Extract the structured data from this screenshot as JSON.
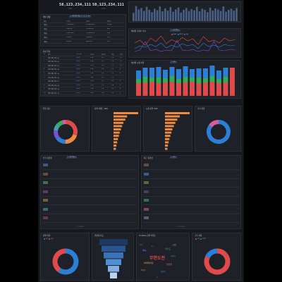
{
  "kpis": [
    {
      "value": "58,123,234,111",
      "sub": "조회수"
    },
    {
      "value": "58,123,234,111",
      "sub": "구독자"
    }
  ],
  "colors": {
    "red": "#e04a4a",
    "blue": "#2d7fd6",
    "green": "#2fae57",
    "orange": "#f08a3c",
    "purple": "#7b4fd3",
    "teal": "#3ea6a0",
    "pink": "#d35fa0",
    "yellow": "#e4c04a",
    "gray": "#7c838d"
  },
  "panels": {
    "top_bar_chart": {
      "title": "",
      "bars": [
        22,
        40,
        31,
        35,
        27,
        38,
        30,
        24,
        33,
        29,
        39,
        26,
        34,
        28,
        37,
        25,
        31,
        36,
        23,
        30,
        35,
        27,
        32,
        29,
        38,
        26,
        33,
        30,
        24,
        36,
        28,
        34,
        31,
        27,
        39,
        25,
        30,
        33,
        28,
        35
      ]
    },
    "channel_table": {
      "title": "채널 현황",
      "tab": "1 · All(전체 채널) / 1 · 2 · 3 · 4 ▾",
      "headers": [
        "채널",
        "구독수",
        "조회수",
        "영상수"
      ],
      "rows": [
        [
          "채널1",
          "1,234,000",
          "12,345,678",
          "1,234"
        ],
        [
          "채널2",
          "234,000",
          "2,345,678",
          "456"
        ],
        [
          "채널3",
          "1,000,000",
          "10,345,678",
          "789"
        ],
        [
          "채널4",
          "12,000",
          "345,678",
          "123"
        ],
        [
          "채널5",
          "50,000",
          "645,678",
          "321"
        ]
      ]
    },
    "line_chart": {
      "title": "채널별 조회수 추이",
      "tab": "1 · All(전체) ▾",
      "legend": [
        "조회수",
        "좋아요",
        "댓글"
      ]
    },
    "video_table": {
      "title": "영상 목록",
      "tab": "1 · All ▾",
      "headers": [
        "#",
        "제목",
        "YouTube",
        "조회수",
        "좋아요",
        "댓글",
        "공유"
      ],
      "rows": [
        [
          "1",
          "영상 제목 예시 01",
          "video",
          "2.1k",
          "3.2",
          "1.5",
          "12"
        ],
        [
          "2",
          "영상 제목 예시 02",
          "video",
          "1.9k",
          "3.0",
          "1.4",
          "11"
        ],
        [
          "3",
          "영상 제목 예시 03",
          "video",
          "1.7k",
          "2.8",
          "1.3",
          "10"
        ],
        [
          "4",
          "영상 제목 예시 04",
          "video",
          "1.6k",
          "2.6",
          "1.2",
          "9"
        ],
        [
          "5",
          "영상 제목 예시 05",
          "video",
          "1.5k",
          "2.4",
          "1.1",
          "8"
        ],
        [
          "6",
          "영상 제목 예시 06",
          "video",
          "1.4k",
          "2.2",
          "1.0",
          "7"
        ],
        [
          "7",
          "영상 제목 예시 07",
          "video",
          "1.3k",
          "2.0",
          "0.9",
          "6"
        ],
        [
          "8",
          "영상 제목 예시 08",
          "video",
          "1.2k",
          "1.8",
          "0.8",
          "5"
        ],
        [
          "9",
          "영상 제목 예시 09",
          "video",
          "1.1k",
          "1.6",
          "0.7",
          "4"
        ],
        [
          "10",
          "영상 제목 예시 10",
          "video",
          "1.0k",
          "1.4",
          "0.6",
          "3"
        ]
      ]
    },
    "stacked_chart": {
      "title": "채널별 시청 비율",
      "tab": "1 · All ▾",
      "legend": [
        "유튜브",
        "블로그",
        "기타",
        "SNS"
      ]
    },
    "donut1": {
      "title": "유입 경로",
      "labels": [
        "검색",
        "추천",
        "외부",
        "채널",
        "기타"
      ]
    },
    "hbar1": {
      "title": "검색 키워드 TOP"
    },
    "hbar2": {
      "title": "시청 지역 TOP"
    },
    "donut2": {
      "title": "기기 유형"
    },
    "list_left": {
      "title": "인기 동영상",
      "tab": "1 · All(전체) ▾"
    },
    "list_right": {
      "title": "최근 동영상",
      "tab": "1 · All ▾"
    },
    "bottom_donut_left": {
      "title": "성별 비율",
      "legend": [
        "남성",
        "여성"
      ]
    },
    "bottom_funnel": {
      "title": "연령대 분포"
    },
    "word_cloud": {
      "title": "YouTube 검색 키워드",
      "words": [
        "무한도전",
        "예능",
        "레전드",
        "하이라이트",
        "명장면",
        "무도",
        "유재석",
        "박명수",
        "정형돈",
        "노홍철",
        "하하",
        "길"
      ]
    },
    "bottom_donut_right": {
      "title": "구독 비율",
      "legend": [
        "구독",
        "비구독"
      ]
    }
  },
  "pager": "‹  1  2  3  4  5  ›"
}
